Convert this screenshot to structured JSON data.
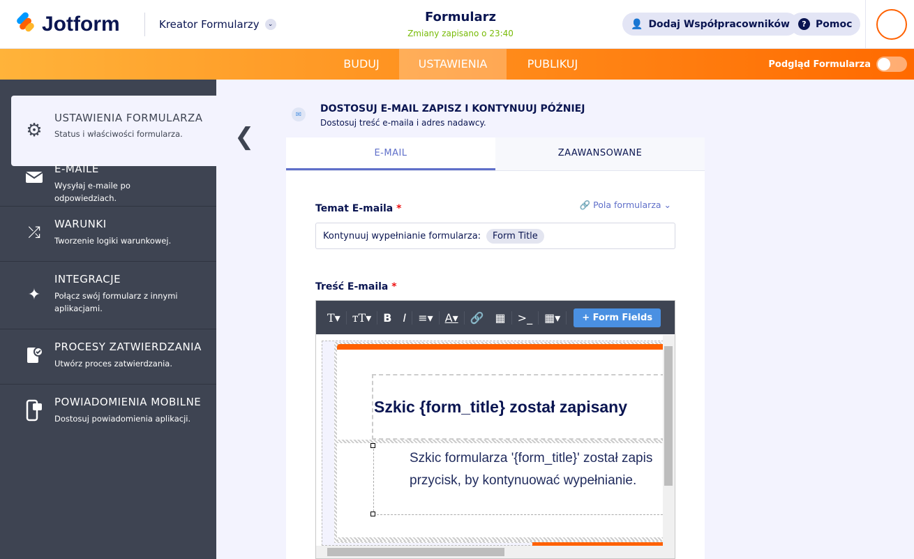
{
  "header": {
    "logo": "Jotform",
    "builder": "Kreator Formularzy",
    "title": "Formularz",
    "saved": "Zmiany zapisano o 23:40",
    "collab": "Dodaj Współpracowników",
    "help": "Pomoc"
  },
  "nav": {
    "tabs": [
      "BUDUJ",
      "USTAWIENIA",
      "PUBLIKUJ"
    ],
    "active": 1,
    "preview": "Podgląd Formularza"
  },
  "sidebar": {
    "items": [
      {
        "title": "USTAWIENIA FORMULARZA",
        "desc": "Status i właściwości formularza.",
        "icon": "gear-icon"
      },
      {
        "title": "E-MAILE",
        "desc": "Wysyłaj e-maile po odpowiedziach.",
        "icon": "envelope-icon"
      },
      {
        "title": "WARUNKI",
        "desc": "Tworzenie logiki warunkowej.",
        "icon": "shuffle-icon"
      },
      {
        "title": "INTEGRACJE",
        "desc": "Połącz swój formularz z innymi aplikacjami.",
        "icon": "puzzle-icon"
      },
      {
        "title": "PROCESY ZATWIERDZANIA",
        "desc": "Utwórz proces zatwierdzania.",
        "icon": "approval-icon"
      },
      {
        "title": "POWIADOMIENIA MOBILNE",
        "desc": "Dostosuj powiadomienia aplikacji.",
        "icon": "mobile-icon"
      }
    ]
  },
  "panel": {
    "title": "DOSTOSUJ E-MAIL ZAPISZ I KONTYNUUJ PÓŹNIEJ",
    "desc": "Dostosuj treść e-maila i adres nadawcy.",
    "tabs": [
      "E-MAIL",
      "ZAAWANSOWANE"
    ],
    "subject_label": "Temat E-maila",
    "form_fields": "Pola formularza",
    "subject_text": "Kontynuuj wypełnianie formularza:",
    "subject_chip": "Form Title",
    "body_label": "Treść E-maila",
    "form_fields_btn": "+ Form Fields",
    "preview_heading": "Szkic {form_title} został zapisany",
    "preview_line1": "Szkic formularza '{form_title}' został zapis",
    "preview_line2": "przycisk, by kontynuować wypełnianie."
  },
  "colors": {
    "accent": "#ff6100",
    "link": "#5f6fc9",
    "sidebar": "#3e4452"
  }
}
